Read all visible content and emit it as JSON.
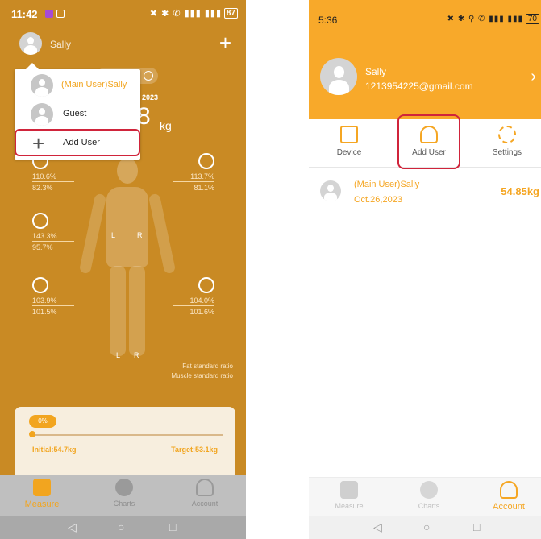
{
  "left": {
    "status": {
      "time": "11:42",
      "battery": "87",
      "signal": "✖ ✱ ✆ ▮▮▮ ▮▮▮"
    },
    "header": {
      "user": "Sally",
      "plus": "+"
    },
    "dropdown": {
      "items": [
        {
          "label": "(Main User)Sally",
          "selected": true
        },
        {
          "label": "Guest",
          "selected": false
        },
        {
          "label": "Add User",
          "icon": "plus-icon"
        }
      ]
    },
    "date_fragment": "2023",
    "weight_fragment": "8",
    "weight_unit": "kg",
    "segments": {
      "left_arm": {
        "v1": "110.6%",
        "v2": "82.3%"
      },
      "right_arm": {
        "v1": "113.7%",
        "v2": "81.1%"
      },
      "trunk": {
        "v1": "143.3%",
        "v2": "95.7%"
      },
      "left_leg": {
        "v1": "103.9%",
        "v2": "101.5%"
      },
      "right_leg": {
        "v1": "104.0%",
        "v2": "101.6%"
      }
    },
    "body_labels": {
      "upper_l": "L",
      "upper_r": "R",
      "lower_l": "L",
      "lower_r": "R"
    },
    "legend": {
      "fat": "Fat standard ratio",
      "muscle": "Muscle standard ratio"
    },
    "progress": {
      "percent": "0%",
      "initial": "Initial:54.7kg",
      "target": "Target:53.1kg"
    },
    "tabs": [
      {
        "label": "Measure",
        "icon": "scale-icon",
        "active": true
      },
      {
        "label": "Charts",
        "icon": "chart-icon",
        "active": false
      },
      {
        "label": "Account",
        "icon": "person-icon",
        "active": false
      }
    ],
    "nav": {
      "back": "◁",
      "home": "○",
      "recent": "□"
    }
  },
  "right": {
    "status": {
      "time": "5:36",
      "battery": "70",
      "signal": "✖ ✱ ⚲ ✆ ▮▮▮ ▮▮▮"
    },
    "profile": {
      "name": "Sally",
      "email": "1213954225@gmail.com",
      "chevron": "›"
    },
    "actions": [
      {
        "label": "Device",
        "icon": "device-icon"
      },
      {
        "label": "Add User",
        "icon": "person-icon"
      },
      {
        "label": "Settings",
        "icon": "gear-icon"
      }
    ],
    "user_row": {
      "name": "(Main User)Sally",
      "date": "Oct.26,2023",
      "weight": "54.85kg"
    },
    "tabs": [
      {
        "label": "Measure",
        "icon": "scale-icon",
        "active": false
      },
      {
        "label": "Charts",
        "icon": "chart-icon",
        "active": false
      },
      {
        "label": "Account",
        "icon": "person-icon",
        "active": true
      }
    ],
    "nav": {
      "back": "◁",
      "home": "○",
      "recent": "□"
    }
  },
  "colors": {
    "accent": "#f5a623",
    "left_bg": "#c98a24",
    "highlight": "#d0243b"
  }
}
